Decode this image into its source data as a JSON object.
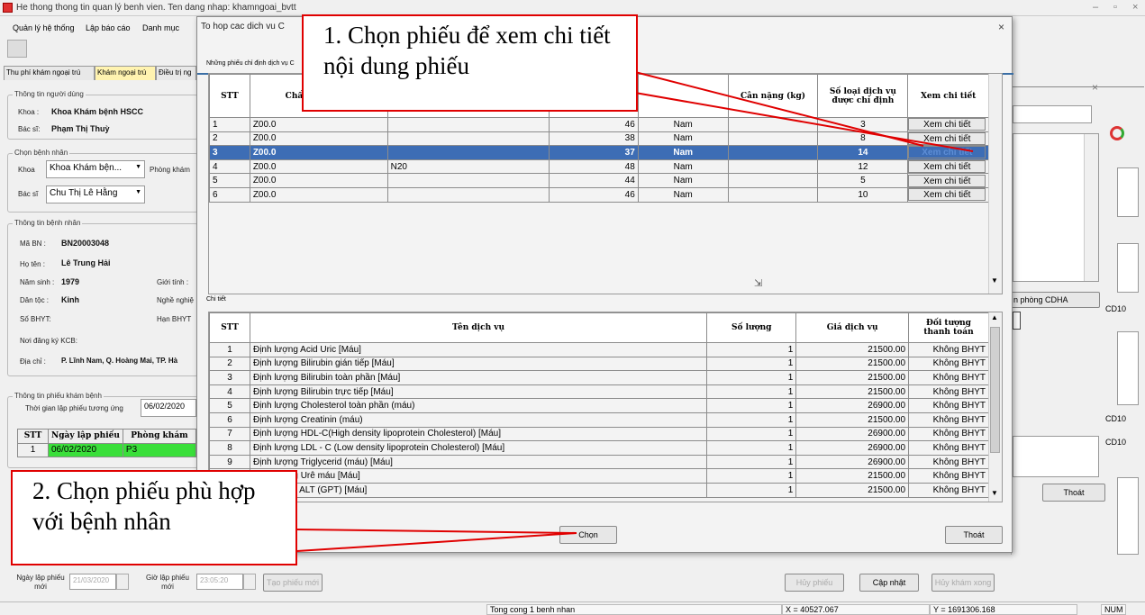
{
  "window": {
    "title": "He thong thong tin quan lý benh vien. Ten dang nhap: khamngoai_bvtt"
  },
  "menu": [
    "Quản lý hệ thống",
    "Lập báo cáo",
    "Danh mục"
  ],
  "tabs": [
    "Thu phí khám ngoại trú",
    "Khám ngoại trú",
    "Điều trị ng"
  ],
  "left": {
    "user_group": "Thông tin người dùng",
    "khoa_label": "Khoa :",
    "khoa_value": "Khoa Khám bệnh  HSCC",
    "bacsi_label": "Bác sĩ:",
    "bacsi_value": "Phạm Thị Thuỳ",
    "chon_group": "Chọn bệnh nhân",
    "khoa2_label": "Khoa",
    "khoa2_value": "Khoa Khám bện...",
    "phong_label": "Phòng khám",
    "bacsi2_label": "Bác sĩ",
    "bacsi2_value": "Chu Thị Lê Hằng",
    "bn_group": "Thông tin bệnh nhân",
    "mabn_label": "Mã BN :",
    "mabn_value": "BN20003048",
    "hoten_label": "Họ tên :",
    "hoten_value": "Lê Trung Hải",
    "namsinh_label": "Năm sinh :",
    "namsinh_value": "1979",
    "gioitinh_label": "Giới tính :",
    "dantoc_label": "Dân tộc :",
    "dantoc_value": "Kinh",
    "nghenghiep_label": "Nghề nghiệ",
    "sobhyt_label": "Số BHYT:",
    "hanbhyt_label": "Hạn BHYT",
    "noidk_label": "Nơi đăng ký KCB:",
    "diachi_label": "Địa chỉ :",
    "diachi_value": "P. Lĩnh Nam, Q. Hoàng Mai, TP. Hà",
    "phieu_group": "Thông tin phiếu khám bệnh",
    "thoigian_label": "Thời gian lập phiếu tương ứng",
    "thoigian_value": "06/02/2020",
    "phieu_headers": [
      "STT",
      "Ngày lập phiếu",
      "Phòng khám"
    ],
    "phieu_row": [
      "1",
      "06/02/2020",
      "P3"
    ]
  },
  "dialog": {
    "title": "To hop cac dich vu C",
    "list_caption": "Những phiếu chỉ định dịch vụ C",
    "top_headers": [
      "STT",
      "Chẩn đ Chẩn đ",
      "",
      "",
      "",
      "Cân nặng (kg)",
      "Số loại dịch vụ được chỉ định",
      "Xem chi tiết"
    ],
    "top_rows": [
      [
        "1",
        "Z00.0",
        "",
        "46",
        "Nam",
        "",
        "3",
        "Xem chi tiết"
      ],
      [
        "2",
        "Z00.0",
        "",
        "38",
        "Nam",
        "",
        "8",
        "Xem chi tiết"
      ],
      [
        "3",
        "Z00.0",
        "",
        "37",
        "Nam",
        "",
        "14",
        "Xem chi tiết"
      ],
      [
        "4",
        "Z00.0",
        "N20",
        "48",
        "Nam",
        "",
        "12",
        "Xem chi tiết"
      ],
      [
        "5",
        "Z00.0",
        "",
        "44",
        "Nam",
        "",
        "5",
        "Xem chi tiết"
      ],
      [
        "6",
        "Z00.0",
        "",
        "46",
        "Nam",
        "",
        "10",
        "Xem chi tiết"
      ]
    ],
    "detail_caption": "Chi tiết",
    "bottom_headers": [
      "STT",
      "Tên dịch vụ",
      "Số lượng",
      "Giá dịch vụ",
      "Đối tượng thanh toán"
    ],
    "bottom_rows": [
      [
        "1",
        "Định lượng Acid Uric [Máu]",
        "1",
        "21500.00",
        "Không BHYT"
      ],
      [
        "2",
        "Định lượng Bilirubin gián tiếp [Máu]",
        "1",
        "21500.00",
        "Không BHYT"
      ],
      [
        "3",
        "Định lượng Bilirubin toàn phần [Máu]",
        "1",
        "21500.00",
        "Không BHYT"
      ],
      [
        "4",
        "Định lượng Bilirubin trực tiếp [Máu]",
        "1",
        "21500.00",
        "Không BHYT"
      ],
      [
        "5",
        "Định lượng Cholesterol toàn phần (máu)",
        "1",
        "26900.00",
        "Không BHYT"
      ],
      [
        "6",
        "Định lượng Creatinin (máu)",
        "1",
        "21500.00",
        "Không BHYT"
      ],
      [
        "7",
        "Định lượng HDL-C(High density lipoprotein Cholesterol) [Máu]",
        "1",
        "26900.00",
        "Không BHYT"
      ],
      [
        "8",
        "Định lượng LDL - C (Low density lipoprotein Cholesterol) [Máu]",
        "1",
        "26900.00",
        "Không BHYT"
      ],
      [
        "9",
        "Định lượng Triglycerid (máu) [Máu]",
        "1",
        "26900.00",
        "Không BHYT"
      ],
      [
        "10",
        "Định lượng Urê máu [Máu]",
        "1",
        "21500.00",
        "Không BHYT"
      ],
      [
        "11",
        "Đo hoạt độ ALT (GPT) [Máu]",
        "1",
        "21500.00",
        "Không BHYT"
      ]
    ],
    "chon": "Chọn",
    "thoat": "Thoát"
  },
  "annotations": {
    "a1": "1. Chọn phiếu để xem chi tiết nội dung phiếu",
    "a2": "2. Chọn phiếu phù hợp với bệnh nhân"
  },
  "right": {
    "phong_btn": "n phòng CDHA",
    "cd10": "CD10",
    "thoat": "Thoát"
  },
  "bottom": {
    "ngay_label": "Ngày lập phiếu mới",
    "ngay_value": "21/03/2020",
    "gio_label": "Giờ lập phiếu mới",
    "gio_value": "23:05:20",
    "tao": "Tạo phiếu mới",
    "huy": "Hủy phiếu",
    "capnhat": "Cập nhật",
    "huykham": "Hủy khám xong"
  },
  "status": {
    "s1": "Tong cong 1 benh nhan",
    "x": "X = 40527.067",
    "y": "Y = 1691306.168",
    "num": "NUM"
  }
}
